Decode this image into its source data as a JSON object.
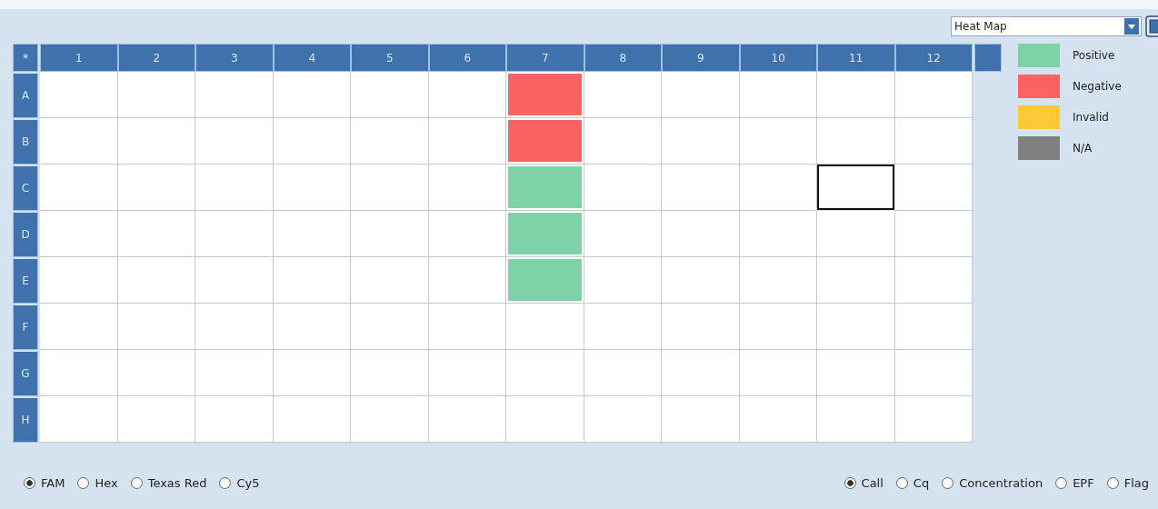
{
  "view_select": {
    "value": "Heat Map"
  },
  "corner": "*",
  "columns": [
    "1",
    "2",
    "3",
    "4",
    "5",
    "6",
    "7",
    "8",
    "9",
    "10",
    "11",
    "12"
  ],
  "rows": [
    {
      "label": "A",
      "cells": [
        {
          "kind": "empty",
          "selected": false
        },
        {
          "kind": "empty",
          "selected": false
        },
        {
          "kind": "empty",
          "selected": false
        },
        {
          "kind": "empty",
          "selected": false
        },
        {
          "kind": "empty",
          "selected": false
        },
        {
          "kind": "empty",
          "selected": false
        },
        {
          "kind": "negative",
          "selected": false
        },
        {
          "kind": "empty",
          "selected": false
        },
        {
          "kind": "empty",
          "selected": false
        },
        {
          "kind": "empty",
          "selected": false
        },
        {
          "kind": "empty",
          "selected": false
        },
        {
          "kind": "empty",
          "selected": false
        }
      ]
    },
    {
      "label": "B",
      "cells": [
        {
          "kind": "empty",
          "selected": false
        },
        {
          "kind": "empty",
          "selected": false
        },
        {
          "kind": "empty",
          "selected": false
        },
        {
          "kind": "empty",
          "selected": false
        },
        {
          "kind": "empty",
          "selected": false
        },
        {
          "kind": "empty",
          "selected": false
        },
        {
          "kind": "negative",
          "selected": false
        },
        {
          "kind": "empty",
          "selected": false
        },
        {
          "kind": "empty",
          "selected": false
        },
        {
          "kind": "empty",
          "selected": false
        },
        {
          "kind": "empty",
          "selected": false
        },
        {
          "kind": "empty",
          "selected": false
        }
      ]
    },
    {
      "label": "C",
      "cells": [
        {
          "kind": "empty",
          "selected": false
        },
        {
          "kind": "empty",
          "selected": false
        },
        {
          "kind": "empty",
          "selected": false
        },
        {
          "kind": "empty",
          "selected": false
        },
        {
          "kind": "empty",
          "selected": false
        },
        {
          "kind": "empty",
          "selected": false
        },
        {
          "kind": "positive",
          "selected": false
        },
        {
          "kind": "empty",
          "selected": false
        },
        {
          "kind": "empty",
          "selected": false
        },
        {
          "kind": "empty",
          "selected": false
        },
        {
          "kind": "empty",
          "selected": true
        },
        {
          "kind": "empty",
          "selected": false
        }
      ]
    },
    {
      "label": "D",
      "cells": [
        {
          "kind": "empty",
          "selected": false
        },
        {
          "kind": "empty",
          "selected": false
        },
        {
          "kind": "empty",
          "selected": false
        },
        {
          "kind": "empty",
          "selected": false
        },
        {
          "kind": "empty",
          "selected": false
        },
        {
          "kind": "empty",
          "selected": false
        },
        {
          "kind": "positive",
          "selected": false
        },
        {
          "kind": "empty",
          "selected": false
        },
        {
          "kind": "empty",
          "selected": false
        },
        {
          "kind": "empty",
          "selected": false
        },
        {
          "kind": "empty",
          "selected": false
        },
        {
          "kind": "empty",
          "selected": false
        }
      ]
    },
    {
      "label": "E",
      "cells": [
        {
          "kind": "empty",
          "selected": false
        },
        {
          "kind": "empty",
          "selected": false
        },
        {
          "kind": "empty",
          "selected": false
        },
        {
          "kind": "empty",
          "selected": false
        },
        {
          "kind": "empty",
          "selected": false
        },
        {
          "kind": "empty",
          "selected": false
        },
        {
          "kind": "positive",
          "selected": false
        },
        {
          "kind": "empty",
          "selected": false
        },
        {
          "kind": "empty",
          "selected": false
        },
        {
          "kind": "empty",
          "selected": false
        },
        {
          "kind": "empty",
          "selected": false
        },
        {
          "kind": "empty",
          "selected": false
        }
      ]
    },
    {
      "label": "F",
      "cells": [
        {
          "kind": "empty",
          "selected": false
        },
        {
          "kind": "empty",
          "selected": false
        },
        {
          "kind": "empty",
          "selected": false
        },
        {
          "kind": "empty",
          "selected": false
        },
        {
          "kind": "empty",
          "selected": false
        },
        {
          "kind": "empty",
          "selected": false
        },
        {
          "kind": "empty",
          "selected": false
        },
        {
          "kind": "empty",
          "selected": false
        },
        {
          "kind": "empty",
          "selected": false
        },
        {
          "kind": "empty",
          "selected": false
        },
        {
          "kind": "empty",
          "selected": false
        },
        {
          "kind": "empty",
          "selected": false
        }
      ]
    },
    {
      "label": "G",
      "cells": [
        {
          "kind": "empty",
          "selected": false
        },
        {
          "kind": "empty",
          "selected": false
        },
        {
          "kind": "empty",
          "selected": false
        },
        {
          "kind": "empty",
          "selected": false
        },
        {
          "kind": "empty",
          "selected": false
        },
        {
          "kind": "empty",
          "selected": false
        },
        {
          "kind": "empty",
          "selected": false
        },
        {
          "kind": "empty",
          "selected": false
        },
        {
          "kind": "empty",
          "selected": false
        },
        {
          "kind": "empty",
          "selected": false
        },
        {
          "kind": "empty",
          "selected": false
        },
        {
          "kind": "empty",
          "selected": false
        }
      ]
    },
    {
      "label": "H",
      "cells": [
        {
          "kind": "empty",
          "selected": false
        },
        {
          "kind": "empty",
          "selected": false
        },
        {
          "kind": "empty",
          "selected": false
        },
        {
          "kind": "empty",
          "selected": false
        },
        {
          "kind": "empty",
          "selected": false
        },
        {
          "kind": "empty",
          "selected": false
        },
        {
          "kind": "empty",
          "selected": false
        },
        {
          "kind": "empty",
          "selected": false
        },
        {
          "kind": "empty",
          "selected": false
        },
        {
          "kind": "empty",
          "selected": false
        },
        {
          "kind": "empty",
          "selected": false
        },
        {
          "kind": "empty",
          "selected": false
        }
      ]
    }
  ],
  "legend": [
    {
      "kind": "positive",
      "label": "Positive",
      "color": "#7dd3a5"
    },
    {
      "kind": "negative",
      "label": "Negative",
      "color": "#fb6363"
    },
    {
      "kind": "invalid",
      "label": "Invalid",
      "color": "#fdc934"
    },
    {
      "kind": "na",
      "label": "N/A",
      "color": "#808080"
    }
  ],
  "dyes": [
    {
      "label": "FAM",
      "selected": true
    },
    {
      "label": "Hex",
      "selected": false
    },
    {
      "label": "Texas Red",
      "selected": false
    },
    {
      "label": "Cy5",
      "selected": false
    }
  ],
  "display": [
    {
      "label": "Call",
      "selected": true
    },
    {
      "label": "Cq",
      "selected": false
    },
    {
      "label": "Concentration",
      "selected": false
    },
    {
      "label": "EPF",
      "selected": false
    },
    {
      "label": "Flag",
      "selected": false
    }
  ]
}
